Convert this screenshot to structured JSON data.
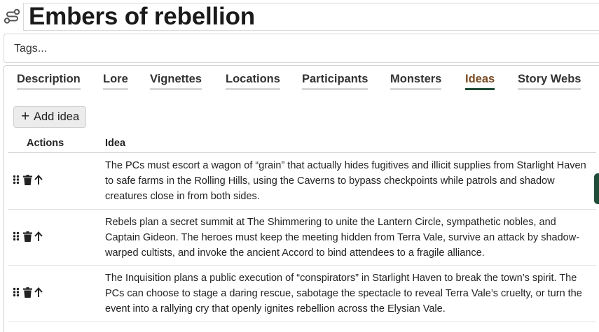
{
  "page": {
    "title": "Embers of rebellion",
    "title_icon": "story-path-icon",
    "tags_placeholder": "Tags..."
  },
  "tabs": [
    {
      "label": "Description"
    },
    {
      "label": "Lore"
    },
    {
      "label": "Vignettes"
    },
    {
      "label": "Locations"
    },
    {
      "label": "Participants"
    },
    {
      "label": "Monsters"
    },
    {
      "label": "Ideas",
      "active": true
    },
    {
      "label": "Story Webs"
    }
  ],
  "ideas_panel": {
    "add_button_label": "Add idea",
    "columns": {
      "actions": "Actions",
      "idea": "Idea"
    },
    "rows": [
      {
        "idea": "The PCs must escort a wagon of “grain” that actually hides fugitives and illicit supplies from Starlight Haven to safe farms in the Rolling Hills, using the Caverns to bypass checkpoints while patrols and shadow creatures close in from both sides."
      },
      {
        "idea": "Rebels plan a secret summit at The Shimmering to unite the Lantern Circle, sympathetic nobles, and Captain Gideon. The heroes must keep the meeting hidden from Terra Vale, survive an attack by shadow-warped cultists, and invoke the ancient Accord to bind attendees to a fragile alliance."
      },
      {
        "idea": "The Inquisition plans a public execution of “conspirators” in Starlight Haven to break the town’s spirit. The PCs can choose to stage a daring rescue, sabotage the spectacle to reveal Terra Vale’s cruelty, or turn the event into a rallying cry that openly ignites rebellion across the Elysian Vale."
      }
    ]
  },
  "colors": {
    "active_tab_text": "#7a4a22",
    "active_tab_underline": "#1f4d3a",
    "accent": "#1f4d3a"
  }
}
